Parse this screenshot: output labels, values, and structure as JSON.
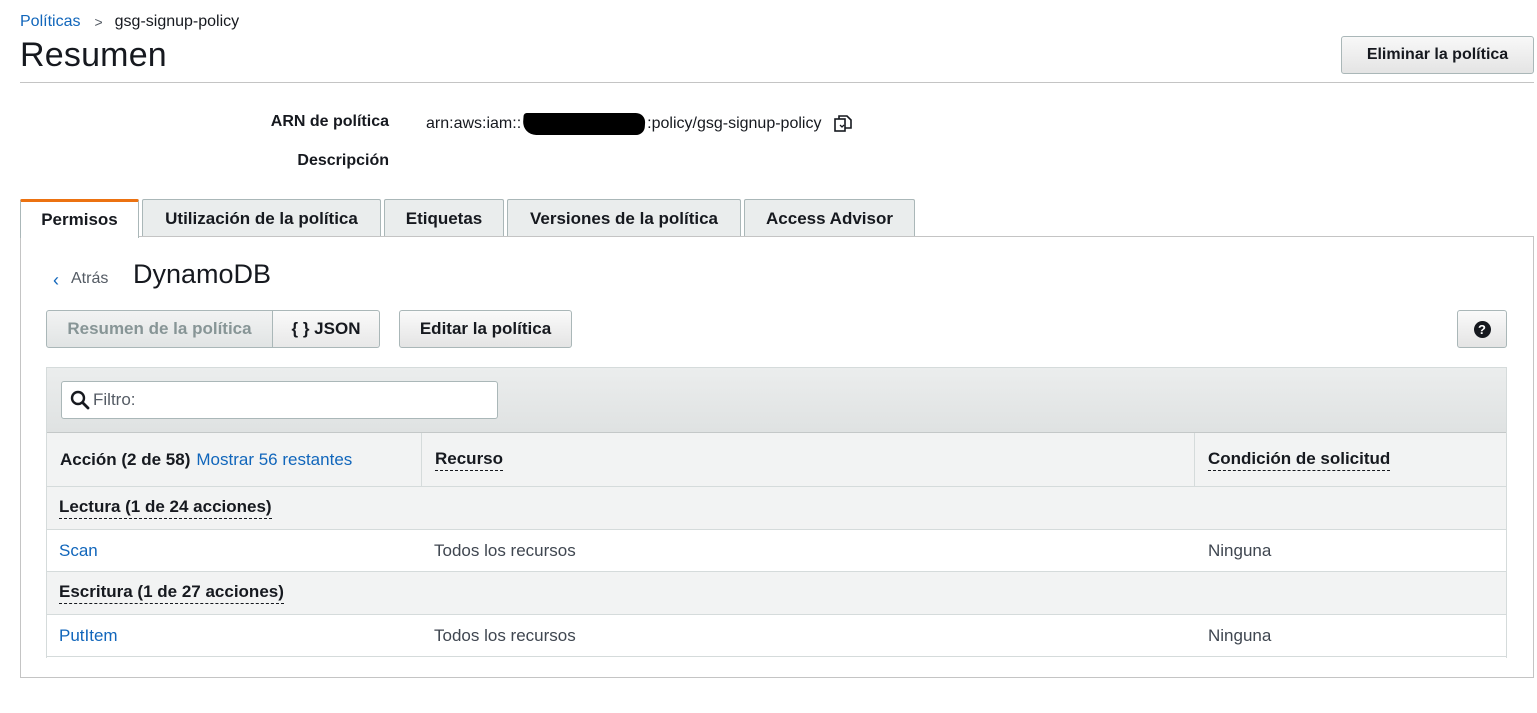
{
  "breadcrumb": {
    "parent": "Políticas",
    "separator": ">",
    "current": "gsg-signup-policy"
  },
  "header": {
    "title": "Resumen",
    "delete_button": "Eliminar la política"
  },
  "meta": {
    "arn_label": "ARN de política",
    "arn_prefix": "arn:aws:iam::",
    "arn_suffix": ":policy/gsg-signup-policy",
    "description_label": "Descripción",
    "description_value": ""
  },
  "tabs": [
    {
      "label": "Permisos",
      "active": true
    },
    {
      "label": "Utilización de la política",
      "active": false
    },
    {
      "label": "Etiquetas",
      "active": false
    },
    {
      "label": "Versiones de la política",
      "active": false
    },
    {
      "label": "Access Advisor",
      "active": false
    }
  ],
  "panel": {
    "back_label": "Atrás",
    "service_title": "DynamoDB",
    "segment_summary": "Resumen de la política",
    "segment_json": "{ } JSON",
    "edit_button": "Editar la política",
    "help_icon": "?"
  },
  "filter": {
    "placeholder": "Filtro:"
  },
  "table": {
    "col_action": "Acción (2 de 58)",
    "show_more": "Mostrar 56 restantes",
    "col_resource": "Recurso",
    "col_condition": "Condición de solicitud",
    "groups": [
      {
        "label": "Lectura (1 de 24 acciones)",
        "rows": [
          {
            "action": "Scan",
            "resource": "Todos los recursos",
            "condition": "Ninguna"
          }
        ]
      },
      {
        "label": "Escritura (1 de 27 acciones)",
        "rows": [
          {
            "action": "PutItem",
            "resource": "Todos los recursos",
            "condition": "Ninguna"
          }
        ]
      }
    ]
  },
  "colors": {
    "link": "#1166bb",
    "tab_active_accent": "#ec7211",
    "text": "#16191f"
  },
  "icons": {
    "copy": "copy-icon",
    "search": "search-icon",
    "back": "chevron-left-icon",
    "help": "help-icon"
  }
}
